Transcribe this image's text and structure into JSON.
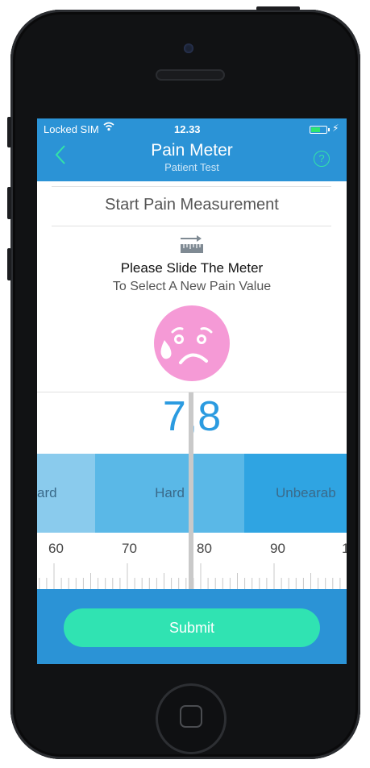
{
  "status_bar": {
    "carrier": "Locked SIM",
    "wifi_icon": "wifi-icon",
    "time": "12.33",
    "battery_icon": "battery-charging-icon"
  },
  "nav": {
    "title": "Pain Meter",
    "subtitle": "Patient Test",
    "back_icon": "chevron-left-icon",
    "help_label": "?"
  },
  "content": {
    "section_title": "Start Pain Measurement",
    "ruler_icon": "ruler-slide-icon",
    "instruction_primary": "Please Slide The Meter",
    "instruction_secondary": "To Select A New Pain Value",
    "face_icon": "sad-sweat-face-icon",
    "face_color": "#f59ad6",
    "pain_value": "7,8"
  },
  "meter": {
    "bands": [
      {
        "label": "ard",
        "color": "#8acbed"
      },
      {
        "label": "Hard",
        "color": "#5ab8e7"
      },
      {
        "label": "Unbearab",
        "color": "#2fa4e2"
      }
    ],
    "tick_labels": [
      "60",
      "70",
      "80",
      "90",
      "1"
    ],
    "accent": "#2b9be0"
  },
  "footer": {
    "submit_label": "Submit",
    "submit_color": "#30e3b2"
  }
}
